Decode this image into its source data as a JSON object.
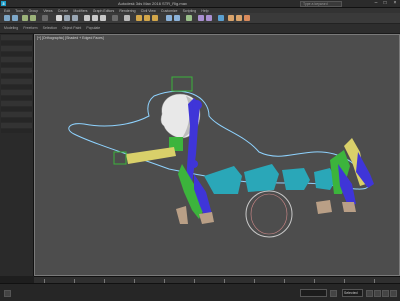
{
  "window": {
    "title": "Autodesk 3ds Max 2016    STR_Rig.max",
    "logo": "3"
  },
  "search": {
    "placeholder": "Type a keyword"
  },
  "menu": {
    "items": [
      "Edit",
      "Tools",
      "Group",
      "Views",
      "Create",
      "Modifiers",
      "Graph Editors",
      "Rendering",
      "Civil View",
      "Customize",
      "Scripting",
      "Help"
    ]
  },
  "ribbon": {
    "items": [
      "Modeling",
      "Freeform",
      "Selection",
      "Object Paint",
      "Populate"
    ]
  },
  "viewport": {
    "label": "[+] [Orthographic] [Shaded + Edged Faces]"
  },
  "status": {
    "selected": "Selected"
  },
  "colors": {
    "accent": "#1b9bc7",
    "spline": "#8fd3ff",
    "limb_blue": "#3f35d8",
    "limb_green": "#3cb43c",
    "spine_teal": "#2aa7b8",
    "bone_yellow": "#d9d06a"
  },
  "icons": [
    "app-logo-icon",
    "minimize-icon",
    "maximize-icon",
    "close-icon",
    "search-icon"
  ]
}
